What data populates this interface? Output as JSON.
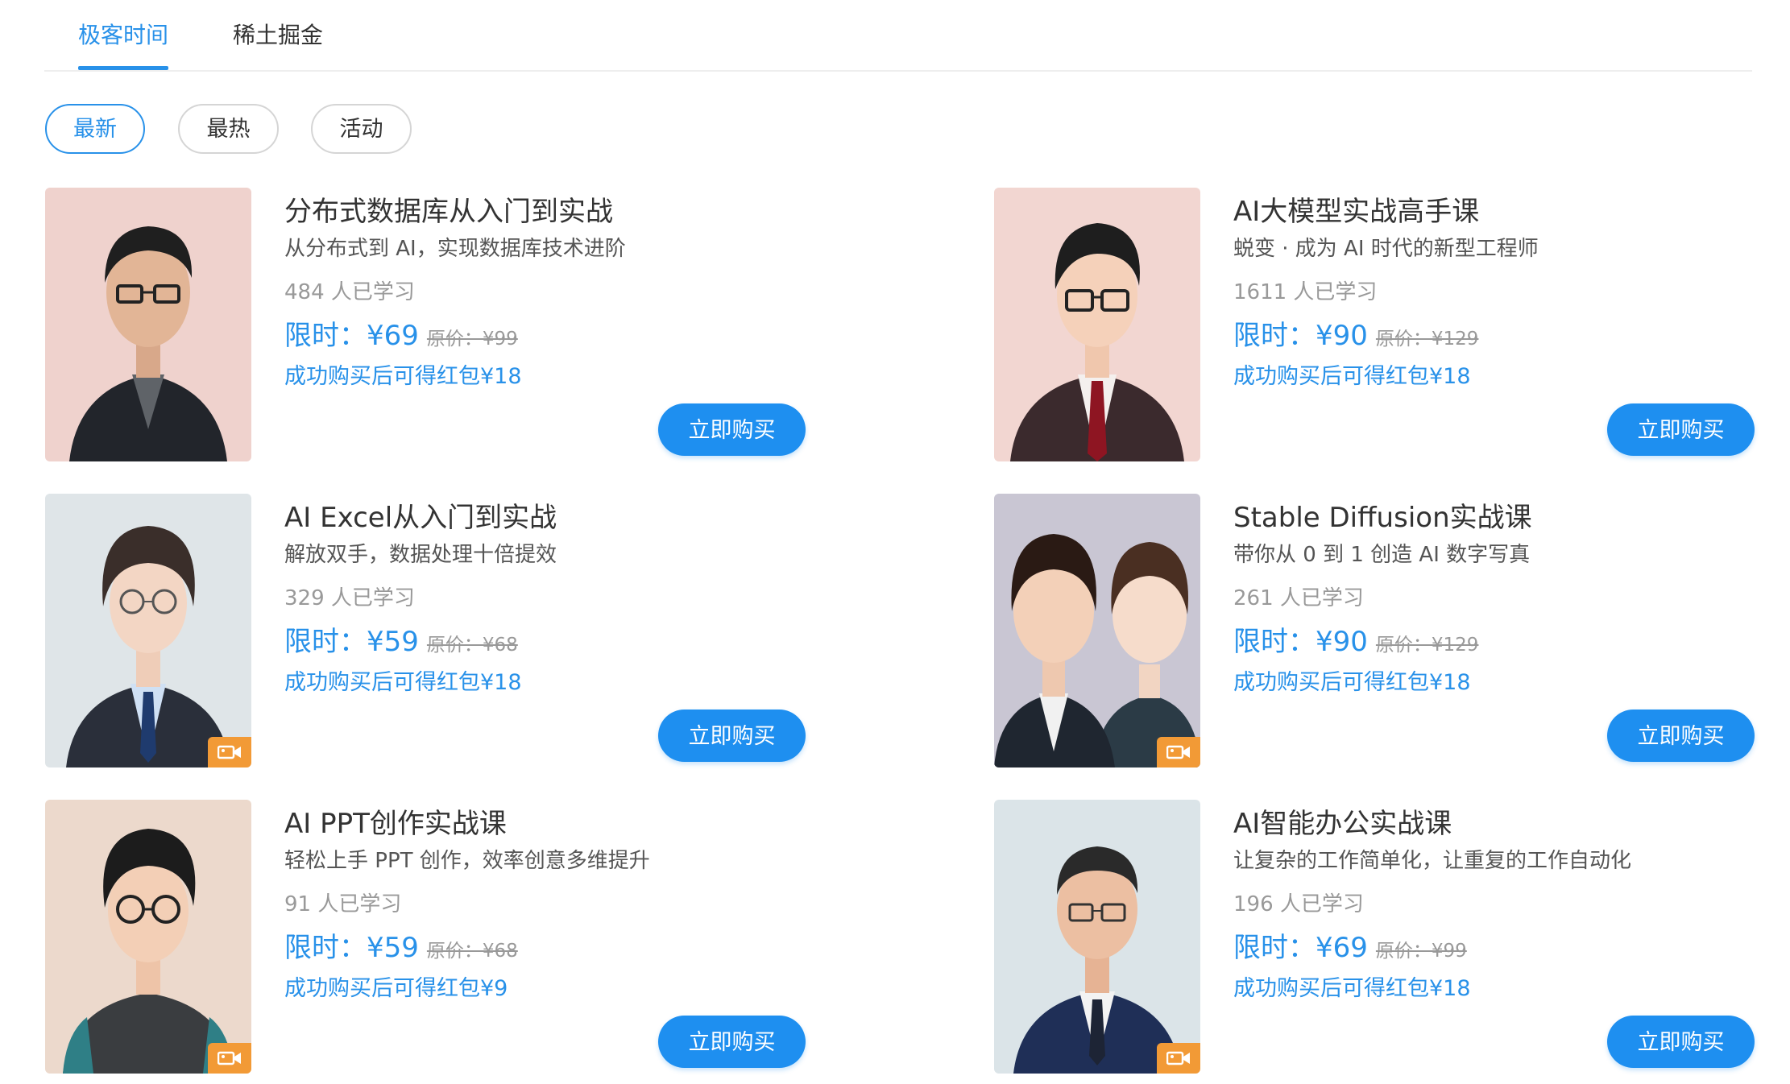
{
  "tabs": [
    "极客时间",
    "稀土掘金"
  ],
  "filters": [
    "最新",
    "最热",
    "活动"
  ],
  "courses": [
    {
      "title": "分布式数据库从入门到实战",
      "subtitle": "从分布式到 AI，实现数据库技术进阶",
      "learners": "484 人已学习",
      "price": "限时：¥69",
      "original_price": "原价：¥99",
      "red_packet": "成功购买后可得红包¥18",
      "buy_label": "立即购买",
      "has_video": false
    },
    {
      "title": "AI大模型实战高手课",
      "subtitle": "蜕变 · 成为 AI 时代的新型工程师",
      "learners": "1611 人已学习",
      "price": "限时：¥90",
      "original_price": "原价：¥129",
      "red_packet": "成功购买后可得红包¥18",
      "buy_label": "立即购买",
      "has_video": false
    },
    {
      "title": "AI Excel从入门到实战",
      "subtitle": "解放双手，数据处理十倍提效",
      "learners": "329 人已学习",
      "price": "限时：¥59",
      "original_price": "原价：¥68",
      "red_packet": "成功购买后可得红包¥18",
      "buy_label": "立即购买",
      "has_video": true
    },
    {
      "title": "Stable Diffusion实战课",
      "subtitle": "带你从 0 到 1 创造 AI 数字写真",
      "learners": "261 人已学习",
      "price": "限时：¥90",
      "original_price": "原价：¥129",
      "red_packet": "成功购买后可得红包¥18",
      "buy_label": "立即购买",
      "has_video": true
    },
    {
      "title": "AI PPT创作实战课",
      "subtitle": "轻松上手 PPT 创作，效率创意多维提升",
      "learners": "91 人已学习",
      "price": "限时：¥59",
      "original_price": "原价：¥68",
      "red_packet": "成功购买后可得红包¥9",
      "buy_label": "立即购买",
      "has_video": true
    },
    {
      "title": "AI智能办公实战课",
      "subtitle": "让复杂的工作简单化，让重复的工作自动化",
      "learners": "196 人已学习",
      "price": "限时：¥69",
      "original_price": "原价：¥99",
      "red_packet": "成功购买后可得红包¥18",
      "buy_label": "立即购买",
      "has_video": true
    }
  ],
  "colors": {
    "accent": "#2891e9",
    "button": "#1e8ff0",
    "video_badge": "#f29a36"
  }
}
